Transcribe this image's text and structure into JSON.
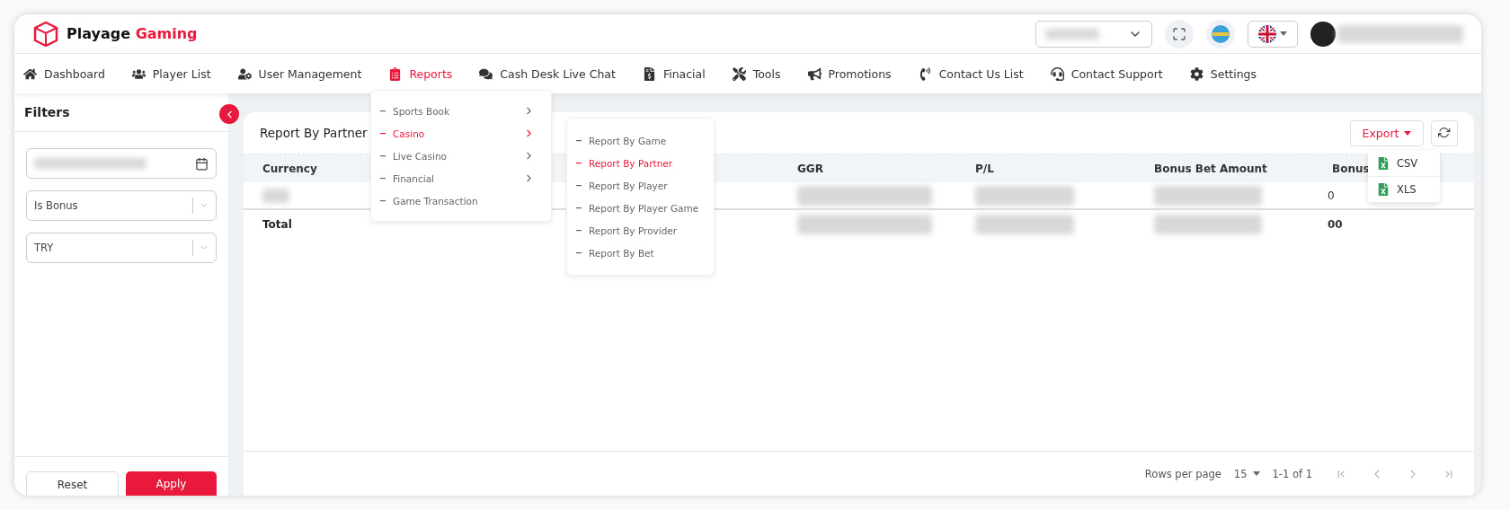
{
  "brand": {
    "primary": "Playage",
    "accent": "Gaming"
  },
  "nav": [
    {
      "label": "Dashboard",
      "selected": false
    },
    {
      "label": "Player List",
      "selected": false
    },
    {
      "label": "User Management",
      "selected": false
    },
    {
      "label": "Reports",
      "selected": true
    },
    {
      "label": "Cash Desk Live Chat",
      "selected": false
    },
    {
      "label": "Finacial",
      "selected": false
    },
    {
      "label": "Tools",
      "selected": false
    },
    {
      "label": "Promotions",
      "selected": false
    },
    {
      "label": "Contact Us List",
      "selected": false
    },
    {
      "label": "Contact Support",
      "selected": false
    },
    {
      "label": "Settings",
      "selected": false
    }
  ],
  "reports_menu": [
    {
      "label": "Sports Book",
      "selected": false,
      "has_submenu": true
    },
    {
      "label": "Casino",
      "selected": true,
      "has_submenu": true
    },
    {
      "label": "Live Casino",
      "selected": false,
      "has_submenu": true
    },
    {
      "label": "Financial",
      "selected": false,
      "has_submenu": true
    },
    {
      "label": "Game Transaction",
      "selected": false,
      "has_submenu": false
    }
  ],
  "casino_submenu": [
    {
      "label": "Report By Game",
      "selected": false
    },
    {
      "label": "Report By Partner",
      "selected": true
    },
    {
      "label": "Report By Player",
      "selected": false
    },
    {
      "label": "Report By Player Game",
      "selected": false
    },
    {
      "label": "Report By Provider",
      "selected": false
    },
    {
      "label": "Report By Bet",
      "selected": false
    }
  ],
  "filters": {
    "title": "Filters",
    "selects": [
      {
        "value": "Is Bonus"
      },
      {
        "value": "TRY"
      }
    ],
    "reset": "Reset",
    "apply": "Apply"
  },
  "report": {
    "title": "Report By Partner",
    "export": {
      "label": "Export",
      "options": [
        "CSV",
        "XLS"
      ]
    },
    "columns": [
      "Currency",
      "GGR",
      "P/L",
      "Bonus Bet Amount",
      "Bonus"
    ],
    "rows": [
      {
        "kind": "data",
        "label": null,
        "bonus": "0"
      },
      {
        "kind": "total",
        "label": "Total",
        "bonus": "00"
      }
    ],
    "footer": {
      "rows_label": "Rows per page",
      "rows_value": "15",
      "range": "1-1 of 1"
    }
  }
}
